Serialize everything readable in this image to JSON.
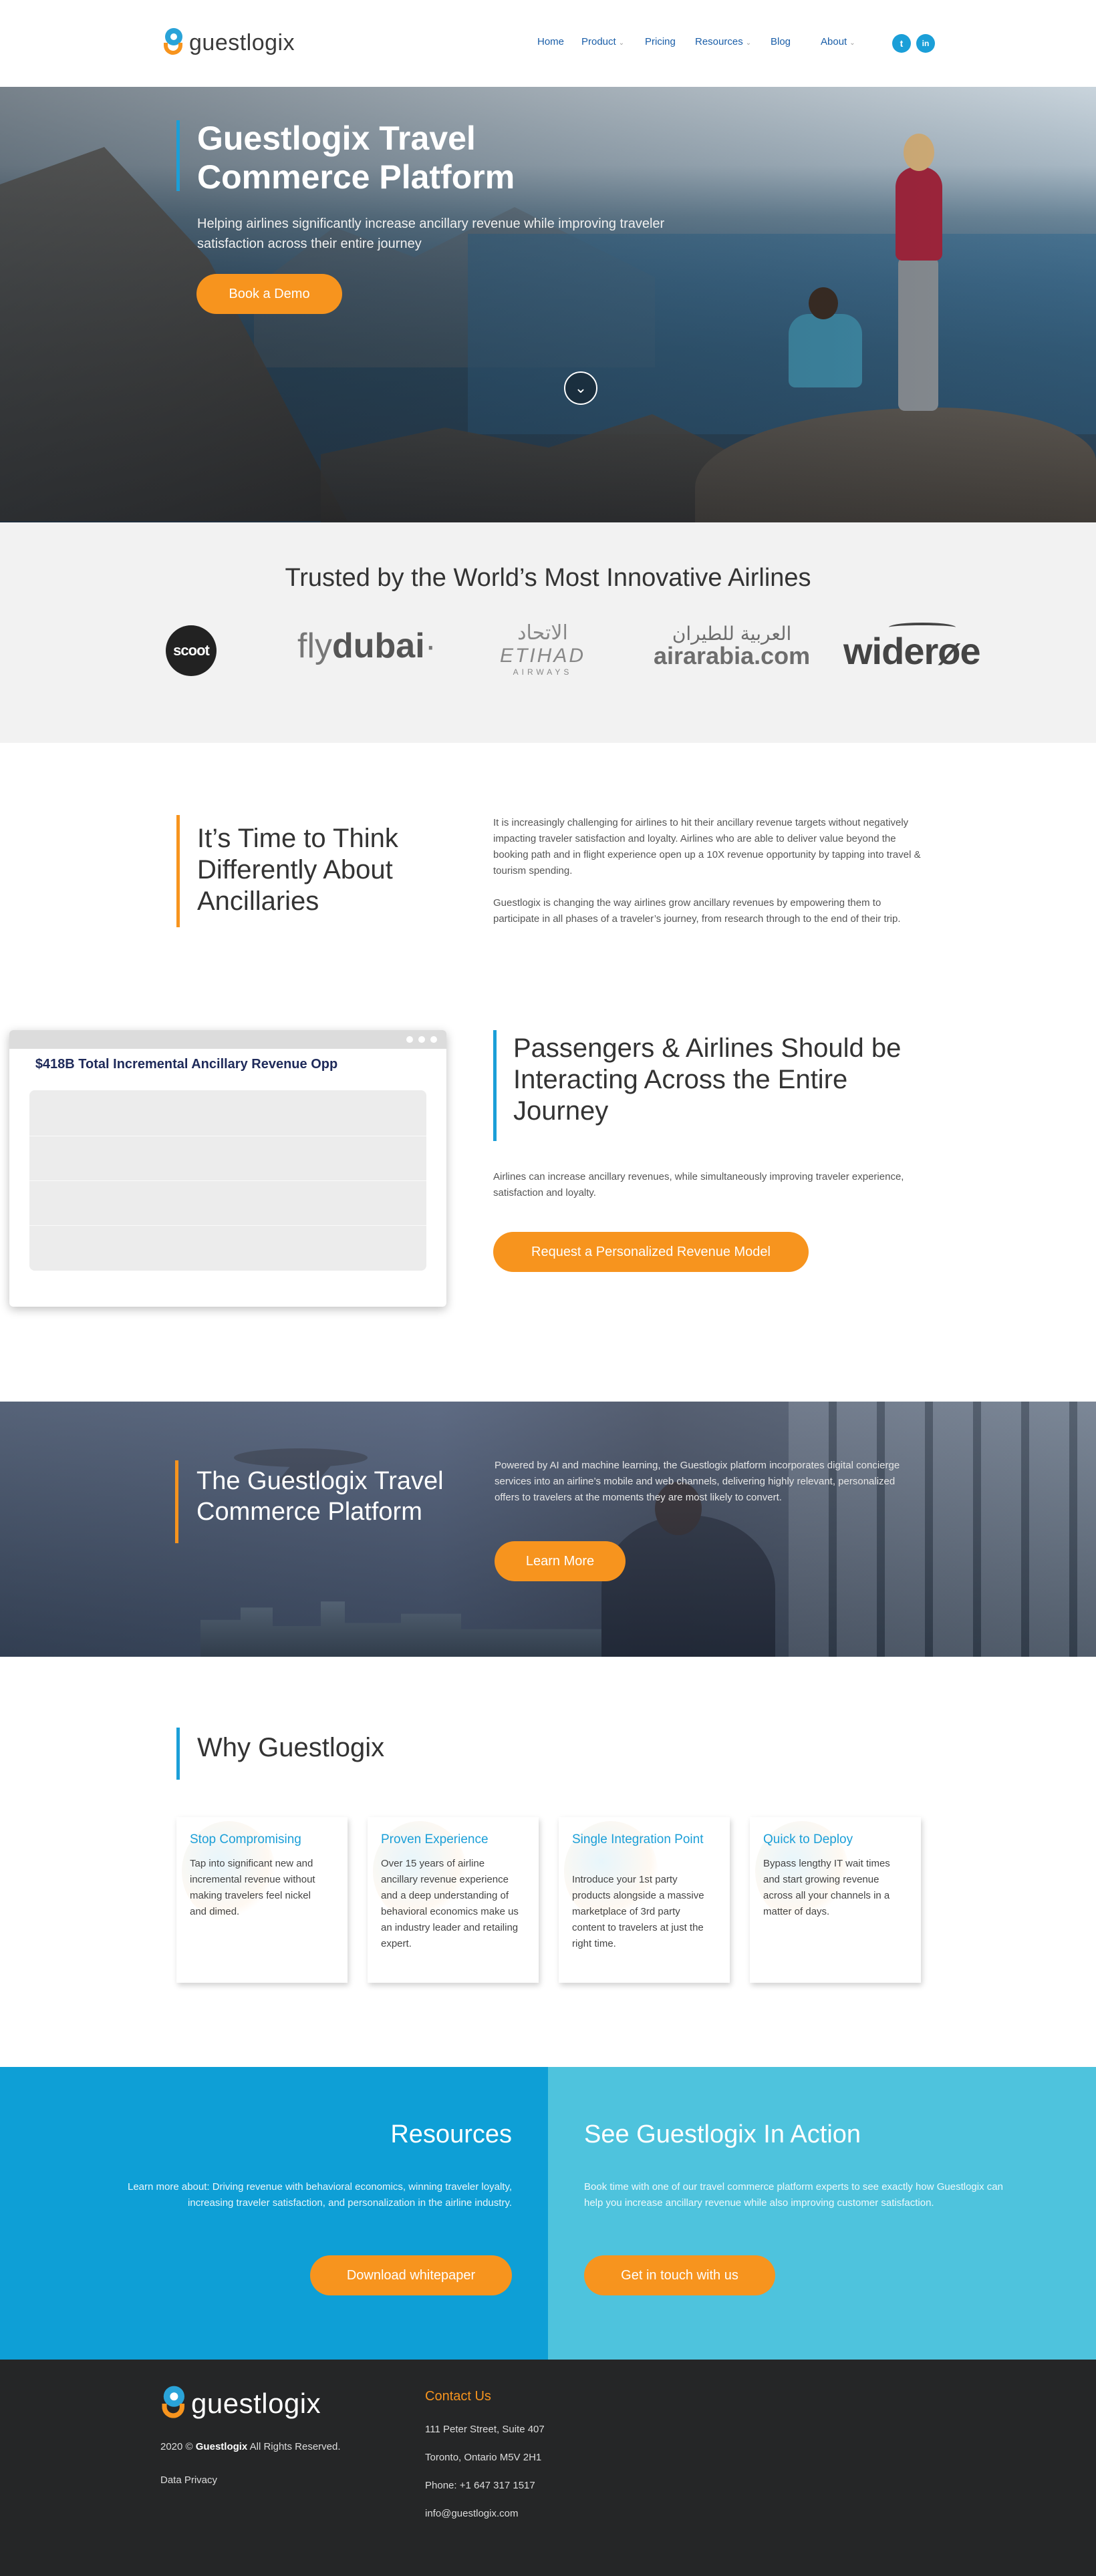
{
  "brand": {
    "name": "guestlogix"
  },
  "nav": {
    "items": [
      {
        "label": "Home"
      },
      {
        "label": "Product"
      },
      {
        "label": "Pricing"
      },
      {
        "label": "Resources"
      },
      {
        "label": "Blog"
      },
      {
        "label": "About"
      }
    ],
    "social": [
      {
        "icon": "twitter-icon",
        "glyph": "t"
      },
      {
        "icon": "linkedin-icon",
        "glyph": "in"
      }
    ],
    "accent": "#1b9fd8"
  },
  "hero": {
    "title": "Guestlogix Travel Commerce Platform",
    "subtitle": "Helping airlines significantly increase ancillary revenue while improving traveler satisfaction across their entire journey",
    "cta": "Book a Demo",
    "scroll_icon": "chevron-down-icon"
  },
  "trusted": {
    "title": "Trusted by the World’s Most Innovative Airlines",
    "logos": [
      {
        "name": "scoot",
        "text": "scoot"
      },
      {
        "name": "flydubai",
        "text_a": "fly",
        "text_b": "dubai",
        "text_c": "·"
      },
      {
        "name": "etihad",
        "ar": "الاتحاد",
        "en": "ETIHAD",
        "sub": "AIRWAYS"
      },
      {
        "name": "airarabia",
        "ar": "العربية للطيران",
        "en": "airarabia.com"
      },
      {
        "name": "wideroe",
        "text": "widerøe"
      }
    ]
  },
  "think": {
    "title": "It’s Time to Think Differently About Ancillaries",
    "p1": "It is increasingly challenging for airlines to hit their ancillary revenue targets without negatively impacting traveler satisfaction and loyalty. Airlines who are able to deliver value beyond the booking path and in flight experience open up a 10X revenue opportunity by tapping into travel & tourism spending.",
    "p2": "Guestlogix is changing the way airlines grow ancillary revenues by empowering them to participate in all phases of a traveler’s journey, from research through to the end of their trip."
  },
  "passengers": {
    "mock_title": "$418B Total Incremental Ancillary Revenue Opp",
    "title": "Passengers & Airlines Should be Interacting Across the Entire Journey",
    "text": "Airlines can increase ancillary revenues, while simultaneously improving traveler experience, satisfaction and loyalty.",
    "cta": "Request a Personalized Revenue Model"
  },
  "platform": {
    "title": "The Guestlogix Travel Commerce Platform",
    "text": "Powered by AI and machine learning, the Guestlogix platform incorporates digital concierge services into an airline’s mobile and web channels, delivering highly relevant, personalized offers to travelers at the moments they are most likely to convert.",
    "cta": "Learn More"
  },
  "why": {
    "title": "Why Guestlogix",
    "cards": [
      {
        "title": "Stop Compromising",
        "text": "Tap into significant new and incremental revenue without making travelers feel nickel and dimed."
      },
      {
        "title": "Proven Experience",
        "text": "Over 15 years of airline ancillary revenue experience and a deep understanding of behavioral economics make us an industry leader and retailing expert."
      },
      {
        "title": "Single Integration Point",
        "text": "Introduce your 1st party products alongside a massive marketplace of 3rd party content to travelers at just the right time."
      },
      {
        "title": "Quick to Deploy",
        "text": "Bypass lengthy IT wait times and start growing revenue across all your channels in a matter of days."
      }
    ]
  },
  "resources": {
    "title": "Resources",
    "text": "Learn more about: Driving revenue with behavioral economics, winning traveler loyalty, increasing traveler satisfaction, and personalization in the airline industry.",
    "cta": "Download whitepaper"
  },
  "action": {
    "title": "See Guestlogix In Action",
    "text": "Book time with one of our travel commerce platform experts to see exactly how Guestlogix can help you increase ancillary revenue while also improving customer satisfaction.",
    "cta": "Get in touch with us"
  },
  "footer": {
    "year": "2020 ©",
    "company": "Guestlogix",
    "rights": "All Rights Reserved.",
    "privacy": "Data Privacy",
    "contact_title": "Contact Us",
    "address1": "111 Peter Street, Suite 407",
    "address2": "Toronto, Ontario M5V 2H1",
    "phone": "Phone: +1 647 317 1517",
    "email": "info@guestlogix.com"
  },
  "colors": {
    "orange": "#f7941e",
    "blue": "#0e9fd6",
    "light_blue": "#4ec3dd",
    "footer": "#252627"
  }
}
